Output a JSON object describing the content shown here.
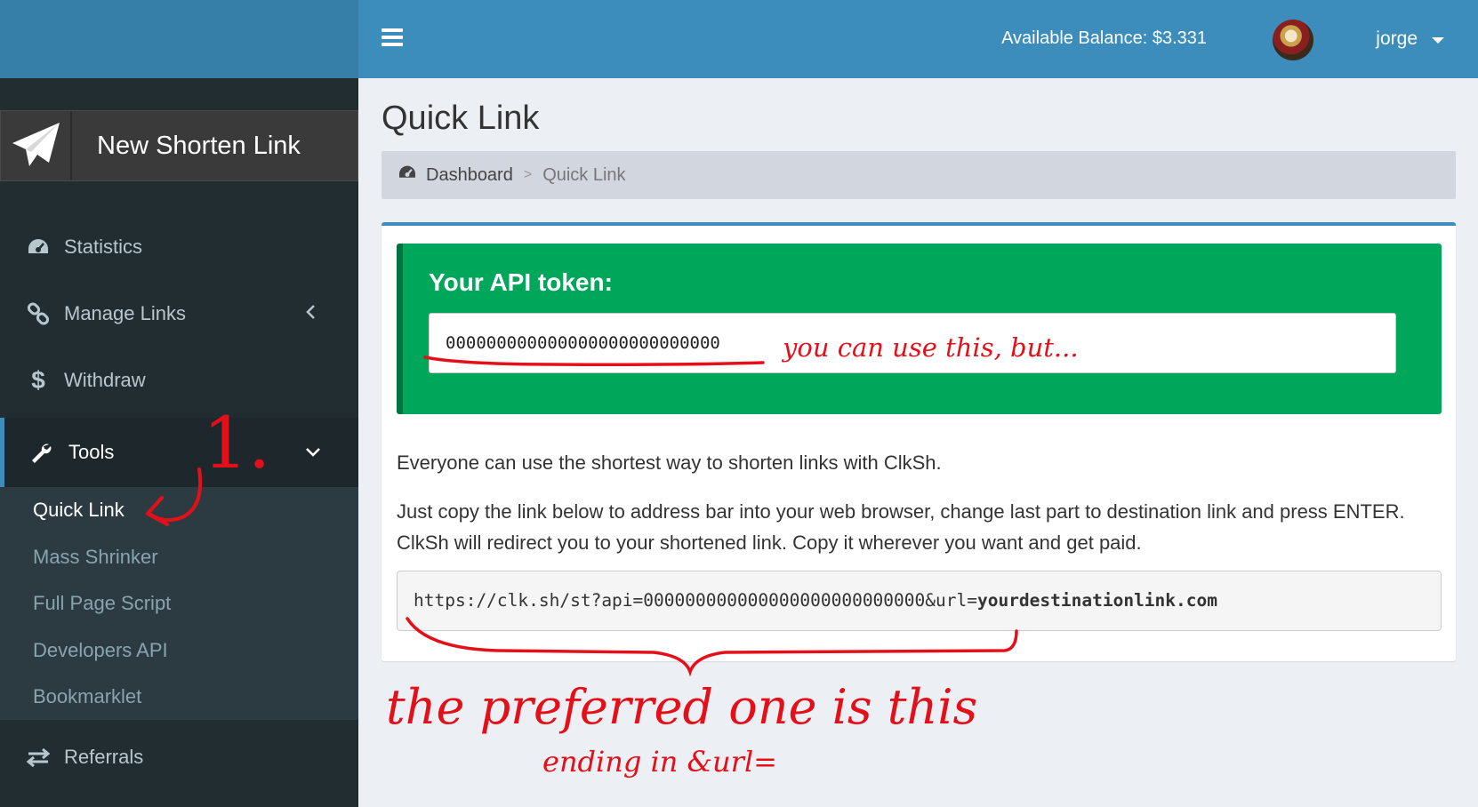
{
  "topbar": {
    "balance": "Available Balance: $3.331",
    "user_name": "jorge"
  },
  "sidebar": {
    "new_link_label": "New Shorten Link",
    "items": [
      {
        "label": "Statistics",
        "icon": "dashboard-icon"
      },
      {
        "label": "Manage Links",
        "icon": "link-icon"
      },
      {
        "label": "Withdraw",
        "icon": "dollar-icon"
      },
      {
        "label": "Tools",
        "icon": "wrench-icon"
      },
      {
        "label": "Referrals",
        "icon": "exchange-icon"
      }
    ],
    "tools_submenu": [
      {
        "label": "Quick Link"
      },
      {
        "label": "Mass Shrinker"
      },
      {
        "label": "Full Page Script"
      },
      {
        "label": "Developers API"
      },
      {
        "label": "Bookmarklet"
      }
    ]
  },
  "page": {
    "title": "Quick Link",
    "breadcrumb": {
      "home": "Dashboard",
      "separator": ">",
      "current": "Quick Link"
    }
  },
  "api_box": {
    "title": "Your API token:",
    "token": "000000000000000000000000000",
    "para1": "Everyone can use the shortest way to shorten links with ClkSh.",
    "para2": "Just copy the link below to address bar into your web browser, change last part to destination link and press ENTER. ClkSh will redirect you to your shortened link. Copy it wherever you want and get paid.",
    "api_url_prefix": "https://clk.sh/st?api=000000000000000000000000000&url=",
    "api_url_dest": "yourdestinationlink.com"
  },
  "annotations": {
    "step": "1.",
    "token_note": "you can use this, but...",
    "preferred": "the preferred one is this",
    "ending": "ending in &url="
  },
  "colors": {
    "topbar": "#3c8dbc",
    "sidebar": "#222d32",
    "callout_success": "#00a65a",
    "annotation": "#e3101a"
  }
}
